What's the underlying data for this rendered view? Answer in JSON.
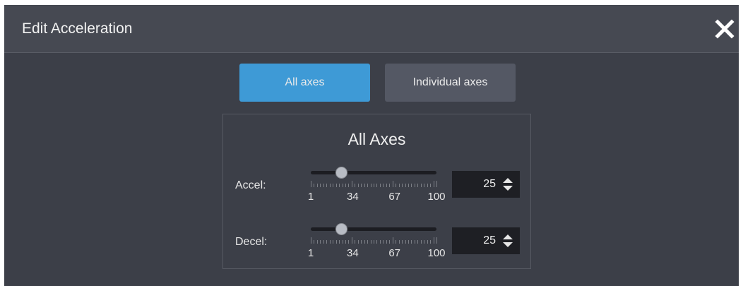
{
  "dialog": {
    "title": "Edit Acceleration",
    "close_icon": "close-icon"
  },
  "tabs": [
    {
      "label": "All axes",
      "selected": true
    },
    {
      "label": "Individual axes",
      "selected": false
    }
  ],
  "colors": {
    "selected_tab": "#3e9ad6",
    "unselected_tab": "#545864",
    "background": "#3c3f48",
    "titlebar": "#464952"
  },
  "panel": {
    "title": "All Axes",
    "min": 1,
    "max": 100,
    "tick_labels": [
      "1",
      "34",
      "67",
      "100"
    ],
    "accel": {
      "label": "Accel:",
      "value": "25"
    },
    "decel": {
      "label": "Decel:",
      "value": "25"
    }
  }
}
